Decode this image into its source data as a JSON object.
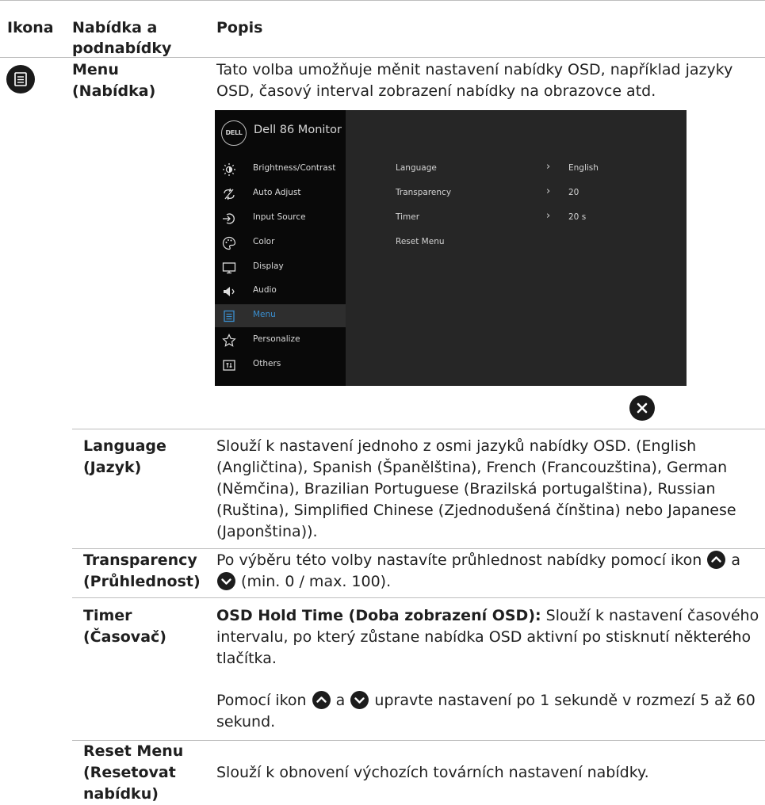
{
  "header": {
    "col_icon": "Ikona",
    "col_menu": "Nabídka a podnabídky",
    "col_desc": "Popis"
  },
  "menu_row": {
    "icon": "menu-list-icon",
    "name": "Menu (Nabídka)",
    "description": "Tato volba umožňuje měnit nastavení nabídky OSD, například jazyky OSD, časový interval zobrazení nabídky na obrazovce atd."
  },
  "osd": {
    "logo": "DELL",
    "title": "Dell 86 Monitor",
    "menu_items": [
      {
        "label": "Brightness/Contrast",
        "icon": "brightness-icon"
      },
      {
        "label": "Auto Adjust",
        "icon": "auto-adjust-icon"
      },
      {
        "label": "Input Source",
        "icon": "input-source-icon"
      },
      {
        "label": "Color",
        "icon": "color-palette-icon"
      },
      {
        "label": "Display",
        "icon": "display-monitor-icon"
      },
      {
        "label": "Audio",
        "icon": "speaker-icon"
      },
      {
        "label": "Menu",
        "icon": "menu-list-icon",
        "active": true
      },
      {
        "label": "Personalize",
        "icon": "star-icon"
      },
      {
        "label": "Others",
        "icon": "others-icon"
      }
    ],
    "settings": [
      {
        "label": "Language",
        "value": "English"
      },
      {
        "label": "Transparency",
        "value": "20"
      },
      {
        "label": "Timer",
        "value": "20 s"
      },
      {
        "label": "Reset Menu",
        "value": ""
      }
    ],
    "active_color": "#3a8fd0",
    "close_icon": "close-icon"
  },
  "rows": {
    "language": {
      "name": "Language (Jazyk)",
      "description": "Slouží k nastavení jednoho z osmi jazyků nabídky OSD. (English (Angličtina), Spanish (Španělština), French (Francouzština), German (Němčina), Brazilian Portuguese (Brazilská portugalština), Russian (Ruština), Simplified Chinese (Zjednodušená čínština) nebo Japanese (Japonština))."
    },
    "transparency": {
      "name": "Transparency (Průhlednost)",
      "desc_before": "Po výběru této volby nastavíte průhlednost nabídky pomocí ikon",
      "desc_mid": "a",
      "desc_after": "(min. 0 / max. 100)."
    },
    "timer": {
      "name": "Timer (Časovač)",
      "desc_bold": "OSD Hold Time (Doba zobrazení OSD):",
      "desc_rest": "Slouží k nastavení časového intervalu, po který zůstane nabídka OSD aktivní po stisknutí některého tlačítka.",
      "desc2_before": "Pomocí ikon",
      "desc2_mid": "a",
      "desc2_after": "upravte nastavení po 1 sekundě v rozmezí 5 až 60 sekund."
    },
    "reset": {
      "name": "Reset Menu (Resetovat nabídku)",
      "description": "Slouží k obnovení výchozích továrních nastavení nabídky."
    }
  }
}
